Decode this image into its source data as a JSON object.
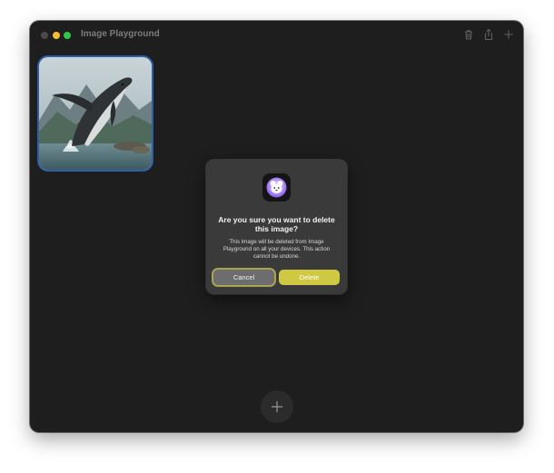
{
  "window": {
    "title": "Image Playground"
  },
  "toolbar": {
    "icons": [
      "trash-icon",
      "share-icon",
      "plus-icon"
    ]
  },
  "gallery": {
    "items": [
      {
        "subject": "whale-breaching-image",
        "selected": true
      }
    ]
  },
  "fab": {
    "icon": "plus-icon"
  },
  "dialog": {
    "app_icon": "image-playground-app-icon",
    "title": "Are you sure you want to delete this image?",
    "message": "This image will be deleted from Image Playground on all your devices. This action cannot be undone.",
    "cancel_label": "Cancel",
    "delete_label": "Delete"
  },
  "colors": {
    "window_bg": "#1e1e1e",
    "dialog_bg": "#3a3a3a",
    "delete_button": "#cfc842",
    "cancel_button": "#6d6d6d",
    "selection_border": "#2f5ea8"
  }
}
